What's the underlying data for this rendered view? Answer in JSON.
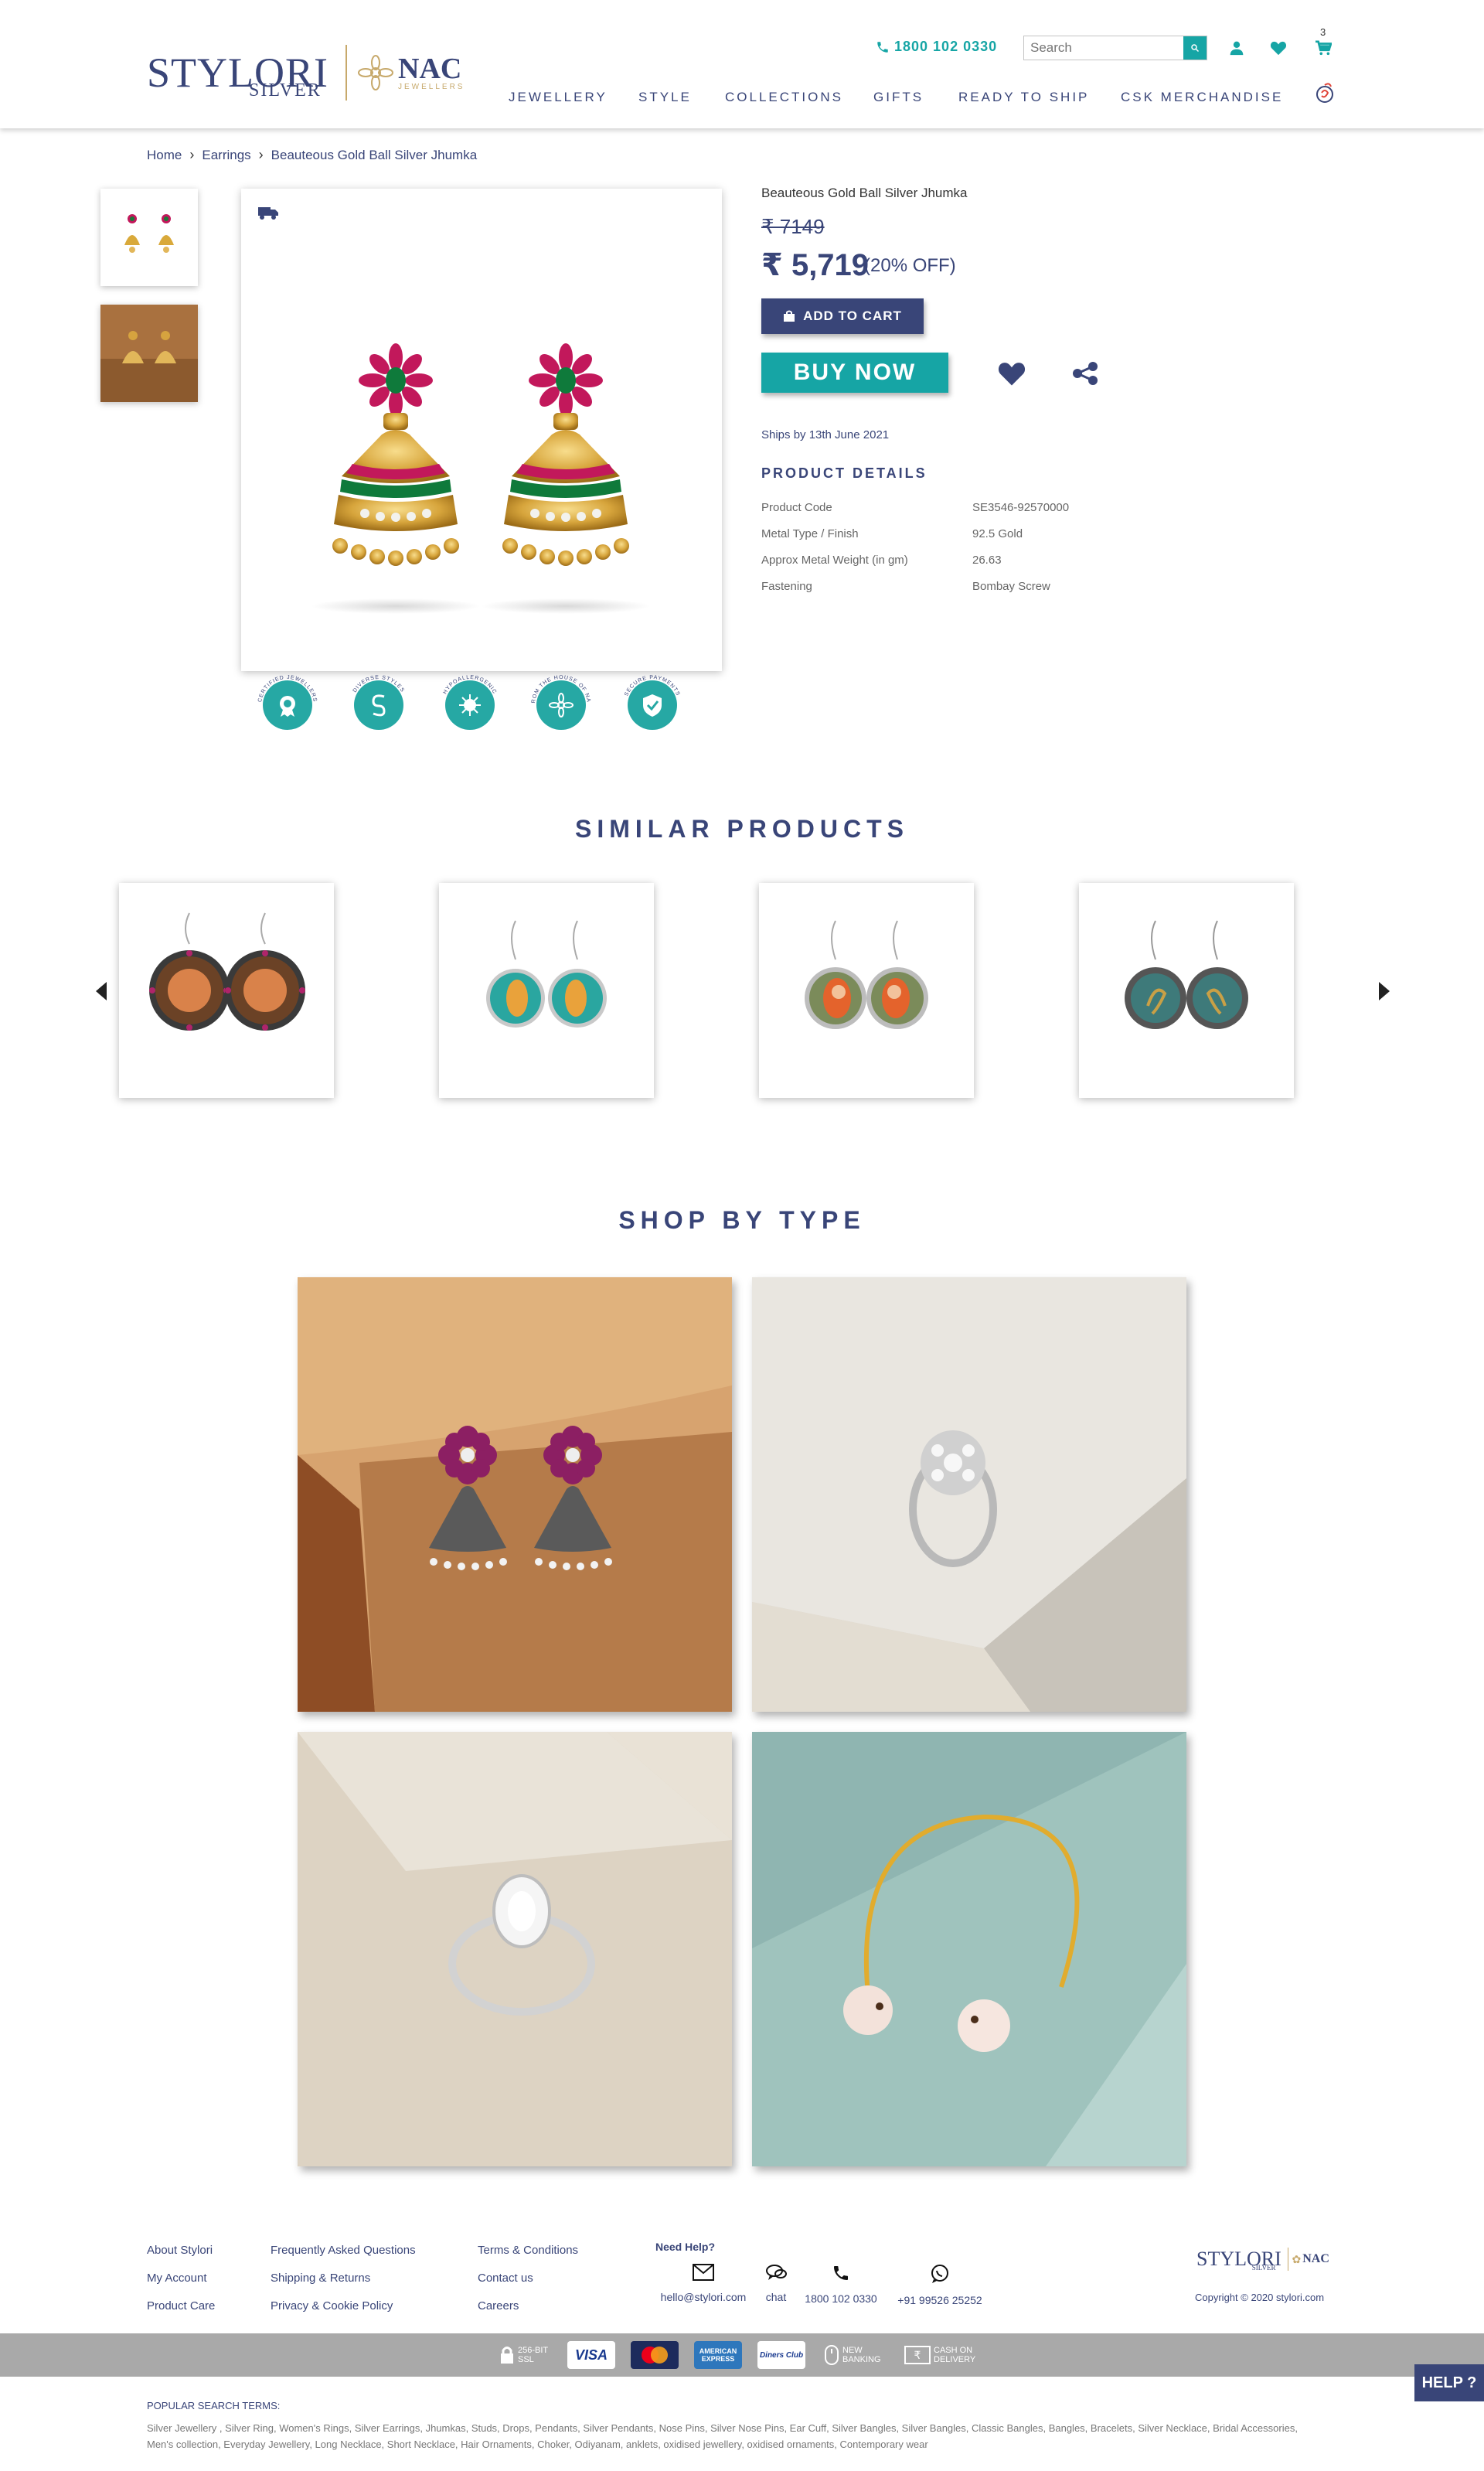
{
  "header": {
    "logo": {
      "brand": "STYLORI",
      "sub": "SILVER",
      "partner": "NAC",
      "partner_sub": "JEWELLERS"
    },
    "phone": "1800 102 0330",
    "search_placeholder": "Search",
    "cart_count": "3",
    "nav": [
      "JEWELLERY",
      "STYLE",
      "COLLECTIONS",
      "GIFTS",
      "READY TO SHIP",
      "CSK MERCHANDISE"
    ]
  },
  "breadcrumb": [
    "Home",
    "Earrings",
    "Beauteous Gold Ball Silver Jhumka"
  ],
  "badges": [
    "CERTIFIED JEWELLERS",
    "DIVERSE STYLES",
    "HYPOALLERGENIC",
    "FROM THE HOUSE OF NAC",
    "SECURE PAYMENTS"
  ],
  "product": {
    "title": "Beauteous Gold Ball Silver Jhumka",
    "old_price": "₹ 7149",
    "price": "₹ 5,719",
    "discount": "(20% OFF)",
    "add_to_cart": "ADD TO CART",
    "buy_now": "BUY NOW",
    "ships": "Ships by 13th June 2021",
    "details_title": "PRODUCT DETAILS",
    "details": [
      {
        "label": "Product Code",
        "value": "SE3546-92570000"
      },
      {
        "label": "Metal Type / Finish",
        "value": "92.5 Gold"
      },
      {
        "label": "Approx Metal Weight (in gm)",
        "value": "26.63"
      },
      {
        "label": "Fastening",
        "value": "Bombay Screw"
      }
    ]
  },
  "similar": {
    "title": "SIMILAR PRODUCTS"
  },
  "shop_by_type": {
    "title": "SHOP BY TYPE"
  },
  "footer": {
    "col1": [
      "About Stylori",
      "My Account",
      "Product Care"
    ],
    "col2": [
      "Frequently Asked Questions",
      "Shipping & Returns",
      "Privacy & Cookie Policy"
    ],
    "col3": [
      "Terms & Conditions",
      "Contact us",
      "Careers"
    ],
    "need_help": "Need Help?",
    "contacts": [
      "hello@stylori.com",
      "chat",
      "1800 102 0330",
      "+91 99526 25252"
    ],
    "copyright": "Copyright © 2020 stylori.com",
    "payments": {
      "ssl": "256-BIT SSL",
      "visa": "VISA",
      "amex": "AMERICAN EXPRESS",
      "diners": "Diners Club",
      "netbanking": "NEW BANKING",
      "cod": "CASH ON DELIVERY"
    },
    "help": "HELP ?",
    "popular_title": "POPULAR SEARCH TERMS:",
    "popular_terms": "Silver Jewellery , Silver Ring, Women's Rings, Silver Earrings, Jhumkas, Studs, Drops, Pendants, Silver Pendants, Nose Pins, Silver Nose Pins, Ear Cuff, Silver Bangles, Silver Bangles, Classic Bangles, Bangles, Bracelets, Silver Necklace, Bridal Accessories, Men's collection, Everyday Jewellery, Long Necklace, Short Necklace, Hair Ornaments, Choker, Odiyanam, anklets, oxidised jewellery, oxidised ornaments, Contemporary wear"
  },
  "colors": {
    "navy": "#394578",
    "teal": "#16a5a5",
    "gold": "#c7a96b"
  }
}
